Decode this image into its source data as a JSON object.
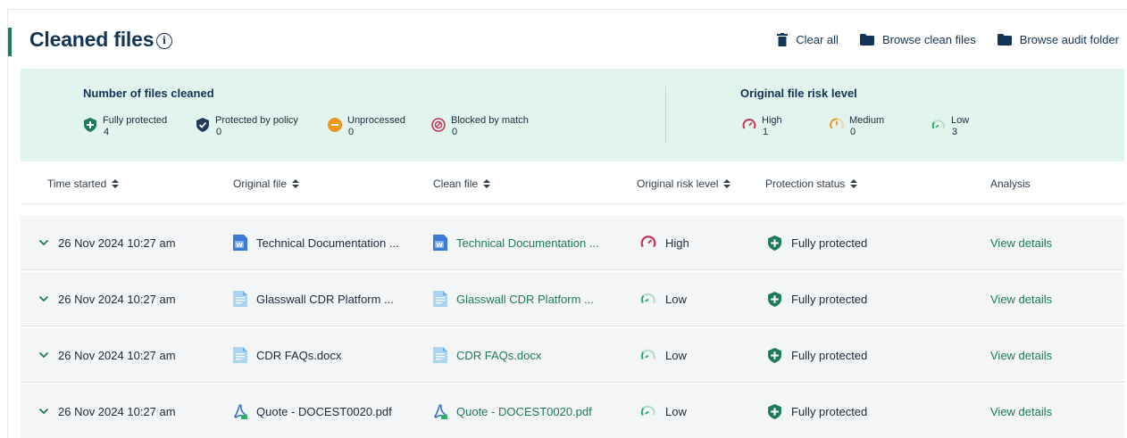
{
  "header": {
    "title": "Cleaned files",
    "info_icon": "info-icon",
    "actions": [
      {
        "label": "Clear all",
        "icon": "trash-icon"
      },
      {
        "label": "Browse clean files",
        "icon": "folder-icon"
      },
      {
        "label": "Browse audit folder",
        "icon": "folder-icon"
      }
    ]
  },
  "summary": {
    "files_cleaned": {
      "heading": "Number of files cleaned",
      "stats": [
        {
          "label": "Fully protected",
          "count": "4",
          "icon": "shield-plus-icon",
          "color": "#1e7a5a"
        },
        {
          "label": "Protected by policy",
          "count": "0",
          "icon": "shield-check-icon",
          "color": "#1f3b5c"
        },
        {
          "label": "Unprocessed",
          "count": "0",
          "icon": "minus-circle-icon",
          "color": "#f0961e"
        },
        {
          "label": "Blocked by match",
          "count": "0",
          "icon": "blocked-icon",
          "color": "#c4385a"
        }
      ]
    },
    "risk_level": {
      "heading": "Original file risk level",
      "stats": [
        {
          "label": "High",
          "count": "1",
          "icon": "gauge-high-icon",
          "color": "#c4385a"
        },
        {
          "label": "Medium",
          "count": "0",
          "icon": "gauge-medium-icon",
          "color": "#f0961e"
        },
        {
          "label": "Low",
          "count": "3",
          "icon": "gauge-low-icon",
          "color": "#2fae6e"
        }
      ]
    }
  },
  "table": {
    "columns": [
      "Time started",
      "Original file",
      "Clean file",
      "Original risk level",
      "Protection status",
      "Analysis"
    ],
    "rows": [
      {
        "time": "26 Nov 2024 10:27 am",
        "original": "Technical Documentation ...",
        "clean": "Technical Documentation ...",
        "file_icon": "word-doc-icon",
        "risk": "High",
        "risk_icon": "gauge-high-icon",
        "status": "Fully protected",
        "action": "View details"
      },
      {
        "time": "26 Nov 2024 10:27 am",
        "original": "Glasswall CDR Platform ...",
        "clean": "Glasswall CDR Platform ...",
        "file_icon": "document-icon",
        "risk": "Low",
        "risk_icon": "gauge-low-icon",
        "status": "Fully protected",
        "action": "View details"
      },
      {
        "time": "26 Nov 2024 10:27 am",
        "original": "CDR FAQs.docx",
        "clean": "CDR FAQs.docx",
        "file_icon": "document-icon",
        "risk": "Low",
        "risk_icon": "gauge-low-icon",
        "status": "Fully protected",
        "action": "View details"
      },
      {
        "time": "26 Nov 2024 10:27 am",
        "original": "Quote - DOCEST0020.pdf",
        "clean": "Quote - DOCEST0020.pdf",
        "file_icon": "pdf-icon",
        "risk": "Low",
        "risk_icon": "gauge-low-icon",
        "status": "Fully protected",
        "action": "View details"
      }
    ]
  },
  "colors": {
    "accent": "#1e7a5a",
    "title": "#123456",
    "summary_bg": "#e1f4ee",
    "row_bg": "#f3f5f6"
  }
}
